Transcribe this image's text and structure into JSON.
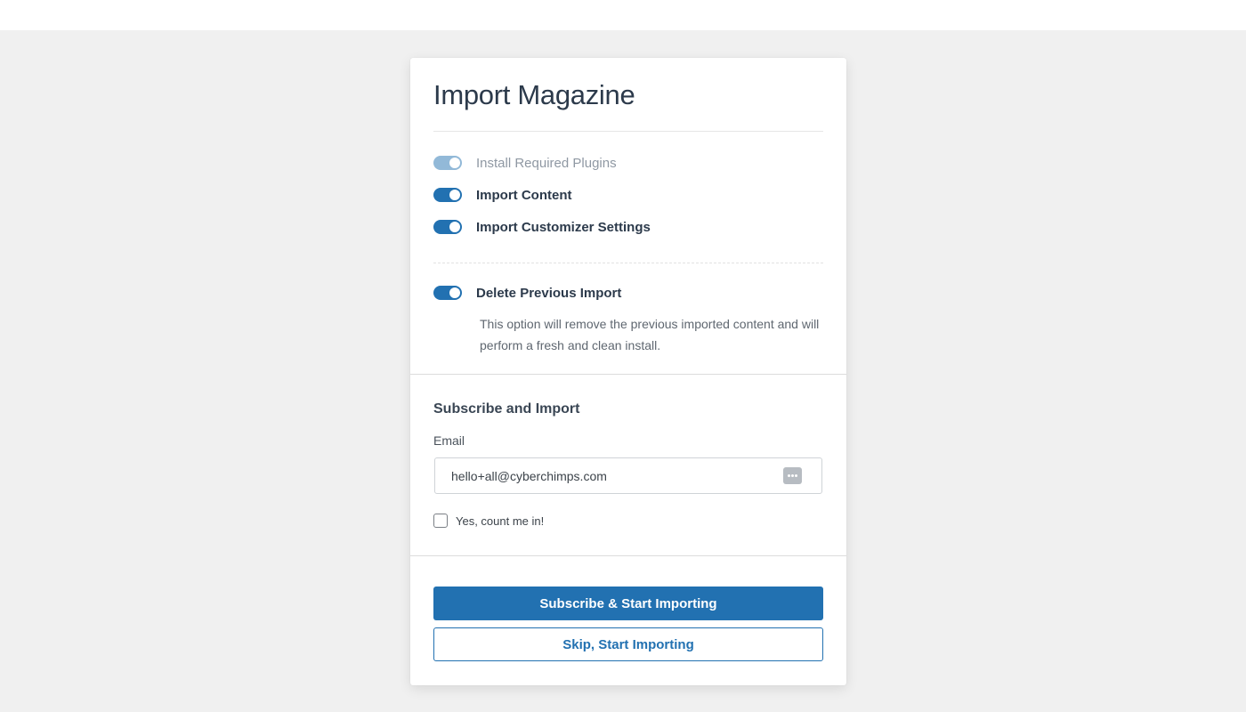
{
  "colors": {
    "accent": "#2271b1",
    "accent_faded": "#92b9d8",
    "heading": "#2c3a4b",
    "backdrop": "#f0f0f0"
  },
  "dialog": {
    "title": "Import Magazine",
    "options": [
      {
        "label": "Install Required Plugins",
        "enabled": true,
        "disabled": true
      },
      {
        "label": "Import Content",
        "enabled": true,
        "disabled": false
      },
      {
        "label": "Import Customizer Settings",
        "enabled": true,
        "disabled": false
      }
    ],
    "delete_previous": {
      "label": "Delete Previous Import",
      "enabled": true,
      "description": "This option will remove the previous imported content and will perform a fresh and clean install."
    }
  },
  "subscribe": {
    "heading": "Subscribe and Import",
    "email_label": "Email",
    "email_value": "hello+all@cyberchimps.com",
    "autofill_icon": "password-manager-icon",
    "consent_label": "Yes, count me in!",
    "consent_checked": false
  },
  "actions": {
    "primary_label": "Subscribe & Start Importing",
    "secondary_label": "Skip, Start Importing"
  }
}
